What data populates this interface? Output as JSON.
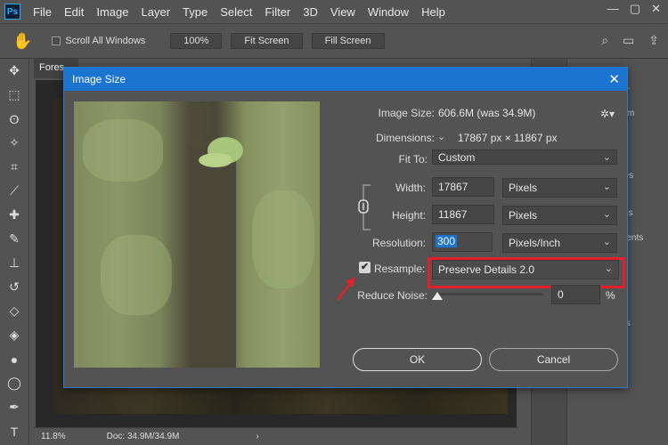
{
  "menubar": {
    "logo": "Ps",
    "items": [
      "File",
      "Edit",
      "Image",
      "Layer",
      "Type",
      "Select",
      "Filter",
      "3D",
      "View",
      "Window",
      "Help"
    ],
    "window_controls": {
      "minimize": "—",
      "restore": "▢",
      "close": "✕"
    }
  },
  "options": {
    "scroll_all_windows": "Scroll All Windows",
    "zoom_100": "100%",
    "fit_screen": "Fit Screen",
    "fill_screen": "Fill Screen"
  },
  "document": {
    "tab": "Fores",
    "zoom": "11.8%",
    "doc_info": "Doc: 34.9M/34.9M",
    "status_arrow": "›"
  },
  "right_panel": {
    "labels": [
      "tor",
      "ram",
      "pes",
      "ties",
      "ments",
      "els"
    ]
  },
  "dialog": {
    "title": "Image Size",
    "image_size_label": "Image Size:",
    "image_size_value": "606.6M (was 34.9M)",
    "dimensions_label": "Dimensions:",
    "dimensions_value": "17867 px  ×  11867 px",
    "fit_to_label": "Fit To:",
    "fit_to_value": "Custom",
    "width_label": "Width:",
    "width_value": "17867",
    "width_unit": "Pixels",
    "height_label": "Height:",
    "height_value": "11867",
    "height_unit": "Pixels",
    "resolution_label": "Resolution:",
    "resolution_value": "300",
    "resolution_unit": "Pixels/Inch",
    "resample_label": "Resample:",
    "resample_value": "Preserve Details 2.0",
    "resample_checked": true,
    "reduce_noise_label": "Reduce Noise:",
    "reduce_noise_value": "0",
    "reduce_noise_unit": "%",
    "ok_label": "OK",
    "cancel_label": "Cancel"
  },
  "colors": {
    "accent": "#1b74d0",
    "highlight": "#e3202a",
    "panel_bg": "#535353"
  },
  "icons": [
    "hand-tool-icon",
    "move-icon",
    "marquee-icon",
    "lasso-icon",
    "magic-wand-icon",
    "crop-icon",
    "eyedropper-icon",
    "healing-icon",
    "brush-icon",
    "stamp-icon",
    "history-brush-icon",
    "eraser-icon",
    "bucket-icon",
    "blur-icon",
    "dodge-icon",
    "pen-icon",
    "type-icon",
    "gear-icon",
    "chain-link-icon",
    "close-icon"
  ]
}
